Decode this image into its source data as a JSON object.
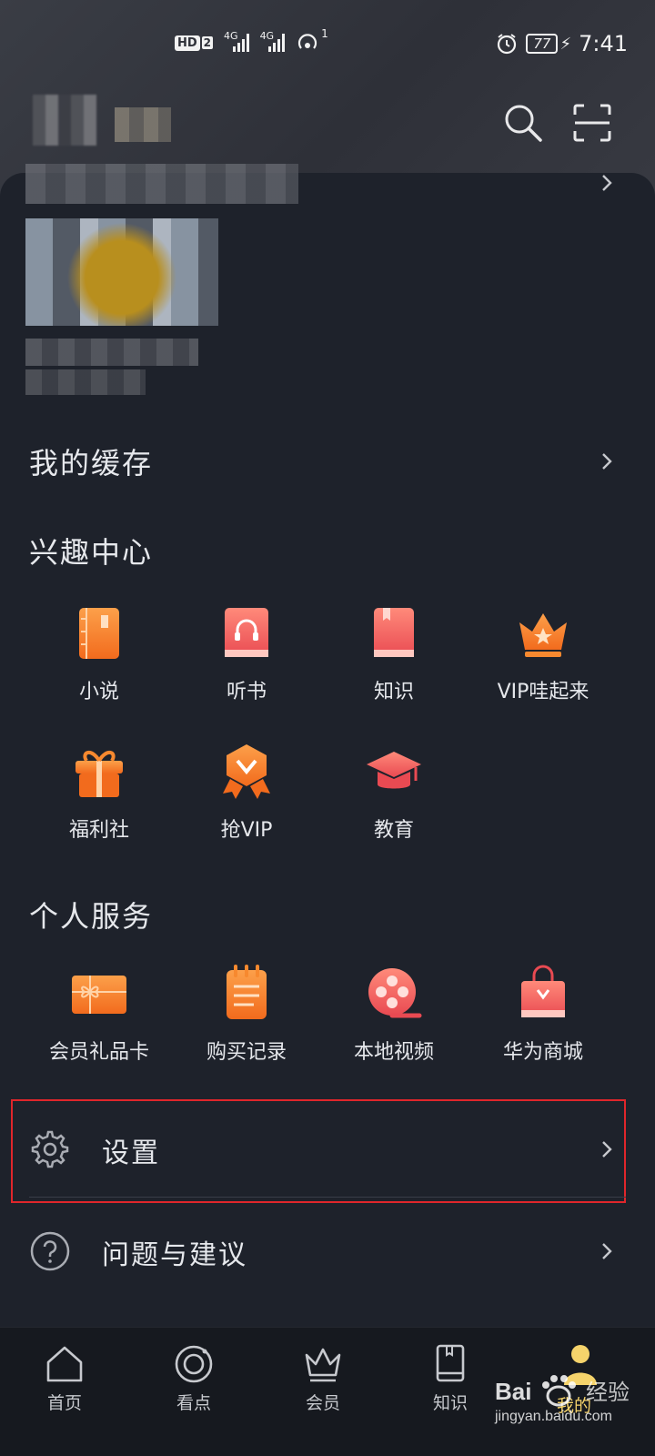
{
  "status_bar": {
    "hd": "HD",
    "sim": "2",
    "net1": "4G",
    "net2": "4G",
    "hotspot_count": "1",
    "battery": "77",
    "time": "7:41"
  },
  "header": {
    "search_icon": "search-icon",
    "scan_icon": "scan-icon"
  },
  "cache": {
    "label": "我的缓存"
  },
  "interest": {
    "title": "兴趣中心",
    "items": [
      {
        "label": "小说",
        "icon": "novel-icon",
        "color": "#f7892f"
      },
      {
        "label": "听书",
        "icon": "audiobook-icon",
        "color": "#f05a5a"
      },
      {
        "label": "知识",
        "icon": "knowledge-icon",
        "color": "#f05a5a"
      },
      {
        "label": "VIP哇起来",
        "icon": "crown-icon",
        "color": "#f7892f"
      },
      {
        "label": "福利社",
        "icon": "gift-icon",
        "color": "#f7892f"
      },
      {
        "label": "抢VIP",
        "icon": "vip-badge-icon",
        "color": "#f7892f"
      },
      {
        "label": "教育",
        "icon": "graduation-cap-icon",
        "color": "#f05a5a"
      }
    ]
  },
  "services": {
    "title": "个人服务",
    "items": [
      {
        "label": "会员礼品卡",
        "icon": "gift-card-icon"
      },
      {
        "label": "购买记录",
        "icon": "purchase-record-icon"
      },
      {
        "label": "本地视频",
        "icon": "local-video-icon"
      },
      {
        "label": "华为商城",
        "icon": "huawei-mall-icon"
      }
    ]
  },
  "settings": {
    "label": "设置"
  },
  "feedback": {
    "label": "问题与建议"
  },
  "bottom_nav": [
    {
      "label": "首页",
      "icon": "home-icon"
    },
    {
      "label": "看点",
      "icon": "discover-icon"
    },
    {
      "label": "会员",
      "icon": "crown-icon"
    },
    {
      "label": "知识",
      "icon": "book-icon"
    },
    {
      "label": "我的",
      "icon": "profile-icon"
    }
  ],
  "watermark": {
    "brand": "Bai",
    "brand_cn": "经验",
    "url": "jingyan.baidu.com"
  },
  "colors": {
    "background": "#1e222b",
    "accent_orange": "#f7892f",
    "accent_red": "#f05a5a",
    "highlight": "#e0262b"
  }
}
